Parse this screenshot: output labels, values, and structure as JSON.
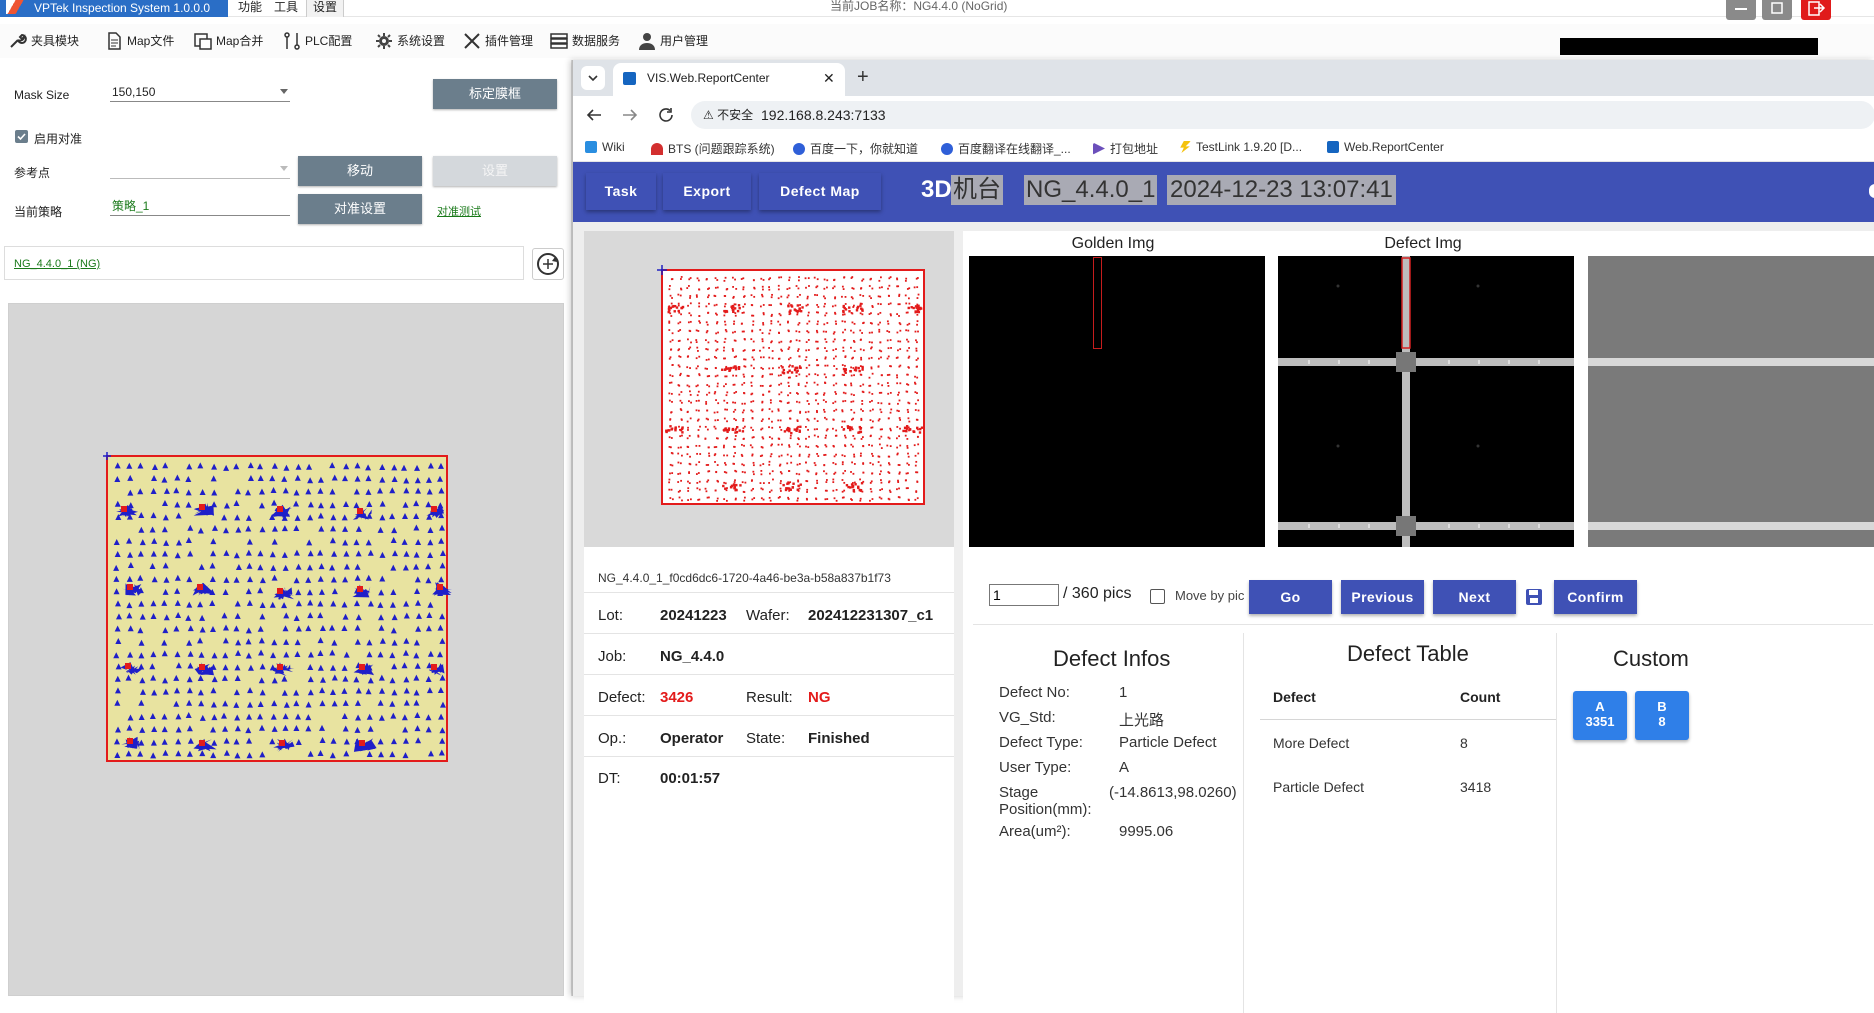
{
  "titlebar": {
    "app_name": "VPTek Inspection System 1.0.0.0",
    "menu": [
      "功能",
      "工具",
      "设置"
    ],
    "job_title": "当前JOB名称：NG4.4.0 (NoGrid)"
  },
  "toolbar": {
    "items": [
      "夹具模块",
      "Map文件",
      "Map合并",
      "PLC配置",
      "系统设置",
      "插件管理",
      "数据服务",
      "用户管理"
    ]
  },
  "left_panel": {
    "mask_size_label": "Mask Size",
    "mask_size_value": "150,150",
    "calib_button": "标定膜框",
    "enable_align_label": "启用对准",
    "ref_point_label": "参考点",
    "move_button": "移动",
    "set_button": "设置",
    "strategy_label": "当前策略",
    "strategy_value": "策略_1",
    "align_settings_button": "对准设置",
    "align_test_link": "对准测试",
    "job_link": "NG_4.4.0_1 (NG)"
  },
  "browser": {
    "tab_title": "VIS.Web.ReportCenter",
    "insecure_label": "不安全",
    "url": "192.168.8.243:7133",
    "bookmarks": [
      "Wiki",
      "BTS (问题跟踪系统)",
      "百度一下，你就知道",
      "百度翻译在线翻译_...",
      "打包地址",
      "TestLink 1.9.20 [D...",
      "Web.ReportCenter"
    ]
  },
  "app": {
    "nav": {
      "task": "Task",
      "export": "Export",
      "defect_map": "Defect Map",
      "machine_prefix": "3D",
      "machine_suffix": "机台",
      "job_name": "NG_4.4.0_1",
      "datetime": "2024-12-23 13:07:41"
    },
    "images": {
      "golden_title": "Golden Img",
      "defect_title": "Defect Img"
    },
    "info": {
      "id": "NG_4.4.0_1_f0cd6dc6-1720-4a46-be3a-b58a837b1f73",
      "lot_label": "Lot:",
      "lot": "20241223",
      "wafer_label": "Wafer:",
      "wafer": "202412231307_c1",
      "job_label": "Job:",
      "job": "NG_4.4.0",
      "defect_label": "Defect:",
      "defect": "3426",
      "result_label": "Result:",
      "result": "NG",
      "op_label": "Op.:",
      "op": "Operator",
      "state_label": "State:",
      "state": "Finished",
      "dt_label": "DT:",
      "dt": "00:01:57"
    },
    "controls": {
      "page_value": "1",
      "pics_label": "/ 360 pics",
      "move_by_pic_label": "Move by pic",
      "go": "Go",
      "previous": "Previous",
      "next": "Next",
      "confirm": "Confirm"
    },
    "defect_infos": {
      "title": "Defect Infos",
      "rows": [
        {
          "k": "Defect No:",
          "v": "1"
        },
        {
          "k": "VG_Std:",
          "v": "上光路"
        },
        {
          "k": "Defect Type:",
          "v": "Particle Defect"
        },
        {
          "k": "User Type:",
          "v": "A"
        },
        {
          "k": "Stage Position(mm):",
          "v": "(-14.8613,98.0260)"
        },
        {
          "k": "Area(um²):",
          "v": "9995.06"
        }
      ]
    },
    "defect_table": {
      "title": "Defect Table",
      "col_defect": "Defect",
      "col_count": "Count",
      "rows": [
        {
          "defect": "More Defect",
          "count": "8"
        },
        {
          "defect": "Particle Defect",
          "count": "3418"
        }
      ]
    },
    "custom": {
      "title": "Custom",
      "buttons": [
        {
          "label": "A",
          "count": "3351"
        },
        {
          "label": "B",
          "count": "8"
        }
      ]
    }
  },
  "colors": {
    "nav": "#3f51b5",
    "map_fill_left": "#e8e3a0",
    "map_die_left": "#1f1fc8",
    "defect_red": "#e31b1b"
  }
}
